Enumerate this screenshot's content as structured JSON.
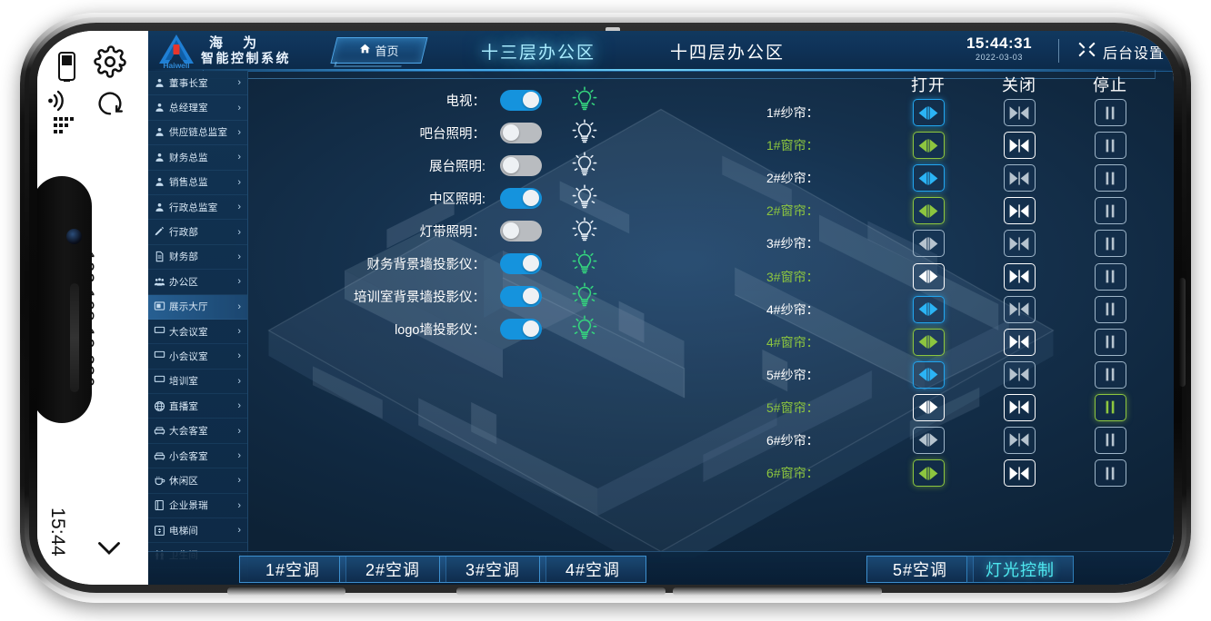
{
  "device": {
    "rail": {
      "battery_icon": "battery-icon",
      "wifi_icon": "wifi-icon",
      "signal_icon": "signal-bars-icon",
      "gear_icon": "gear-icon",
      "refresh_icon": "refresh-icon",
      "ip_address": "192.168.10.236",
      "time": "15:44",
      "chevron_icon": "chevron-down-icon"
    }
  },
  "header": {
    "brand_line1": "海  为",
    "brand_line2": "智能控制系统",
    "logo_text": "Haiwell",
    "home_tab": {
      "label": "首页",
      "icon": "home-icon"
    },
    "floor_tabs": [
      {
        "label": "十三层办公区",
        "active": true
      },
      {
        "label": "十四层办公区",
        "active": false
      }
    ],
    "clock_time": "15:44:31",
    "clock_date": "2022-03-03",
    "settings": {
      "label": "后台设置",
      "icon": "wrench-icon"
    }
  },
  "sidebar": {
    "items": [
      {
        "label": "董事长室",
        "icon": "person-icon",
        "selected": false
      },
      {
        "label": "总经理室",
        "icon": "person-icon",
        "selected": false
      },
      {
        "label": "供应链总监室",
        "icon": "person-icon",
        "selected": false
      },
      {
        "label": "财务总监",
        "icon": "person-icon",
        "selected": false
      },
      {
        "label": "销售总监",
        "icon": "person-icon",
        "selected": false
      },
      {
        "label": "行政总监室",
        "icon": "person-icon",
        "selected": false
      },
      {
        "label": "行政部",
        "icon": "pen-icon",
        "selected": false
      },
      {
        "label": "财务部",
        "icon": "document-icon",
        "selected": false
      },
      {
        "label": "办公区",
        "icon": "group-icon",
        "selected": false
      },
      {
        "label": "展示大厅",
        "icon": "display-icon",
        "selected": true
      },
      {
        "label": "大会议室",
        "icon": "meeting-icon",
        "selected": false
      },
      {
        "label": "小会议室",
        "icon": "meeting-icon",
        "selected": false
      },
      {
        "label": "培训室",
        "icon": "meeting-icon",
        "selected": false
      },
      {
        "label": "直播室",
        "icon": "globe-icon",
        "selected": false
      },
      {
        "label": "大会客室",
        "icon": "sofa-icon",
        "selected": false
      },
      {
        "label": "小会客室",
        "icon": "sofa-icon",
        "selected": false
      },
      {
        "label": "休闲区",
        "icon": "cup-icon",
        "selected": false
      },
      {
        "label": "企业景瑞",
        "icon": "book-icon",
        "selected": false
      },
      {
        "label": "电梯间",
        "icon": "elevator-icon",
        "selected": false
      },
      {
        "label": "卫生间",
        "icon": "restroom-icon",
        "selected": false
      }
    ]
  },
  "lights": {
    "rows": [
      {
        "label": "电视：",
        "state": "on",
        "bulb": "on"
      },
      {
        "label": "吧台照明：",
        "state": "off",
        "bulb": "off"
      },
      {
        "label": "展台照明:",
        "state": "off",
        "bulb": "off"
      },
      {
        "label": "中区照明:",
        "state": "on",
        "bulb": "off"
      },
      {
        "label": "灯带照明：",
        "state": "off",
        "bulb": "off"
      },
      {
        "label": "财务背景墙投影仪：",
        "state": "on",
        "bulb": "on"
      },
      {
        "label": "培训室背景墙投影仪：",
        "state": "on",
        "bulb": "on"
      },
      {
        "label": "logo墙投影仪：",
        "state": "on",
        "bulb": "on"
      }
    ]
  },
  "curtains": {
    "columns": [
      "打开",
      "关闭",
      "停止"
    ],
    "rows": [
      {
        "label": "1#纱帘：",
        "type": "sheer",
        "open": "blue",
        "close": "dim",
        "stop": "dim"
      },
      {
        "label": "1#窗帘：",
        "type": "drape",
        "open": "green",
        "close": "white",
        "stop": "dim"
      },
      {
        "label": "2#纱帘：",
        "type": "sheer",
        "open": "blue",
        "close": "dim",
        "stop": "dim"
      },
      {
        "label": "2#窗帘：",
        "type": "drape",
        "open": "green",
        "close": "white",
        "stop": "dim"
      },
      {
        "label": "3#纱帘：",
        "type": "sheer",
        "open": "dim",
        "close": "dim",
        "stop": "dim"
      },
      {
        "label": "3#窗帘：",
        "type": "drape",
        "open": "white",
        "close": "white",
        "stop": "dim"
      },
      {
        "label": "4#纱帘：",
        "type": "sheer",
        "open": "blue",
        "close": "dim",
        "stop": "dim"
      },
      {
        "label": "4#窗帘：",
        "type": "drape",
        "open": "green",
        "close": "white",
        "stop": "dim"
      },
      {
        "label": "5#纱帘：",
        "type": "sheer",
        "open": "blue",
        "close": "dim",
        "stop": "dim"
      },
      {
        "label": "5#窗帘：",
        "type": "drape",
        "open": "white",
        "close": "white",
        "stop": "green"
      },
      {
        "label": "6#纱帘：",
        "type": "sheer",
        "open": "dim",
        "close": "dim",
        "stop": "dim"
      },
      {
        "label": "6#窗帘：",
        "type": "drape",
        "open": "green",
        "close": "white",
        "stop": "dim"
      }
    ]
  },
  "bottom_bar": {
    "left_buttons": [
      {
        "label": "1#空调",
        "active": false
      },
      {
        "label": "2#空调",
        "active": false
      },
      {
        "label": "3#空调",
        "active": false
      },
      {
        "label": "4#空调",
        "active": false
      }
    ],
    "right_buttons": [
      {
        "label": "5#空调",
        "active": false
      },
      {
        "label": "灯光控制",
        "active": true
      }
    ]
  },
  "colors": {
    "accent_blue": "#1593dd",
    "accent_green": "#8dc63f",
    "accent_cyan": "#4ee8f0",
    "header_bg": "#0f3359",
    "sidebar_bg": "#123454"
  }
}
